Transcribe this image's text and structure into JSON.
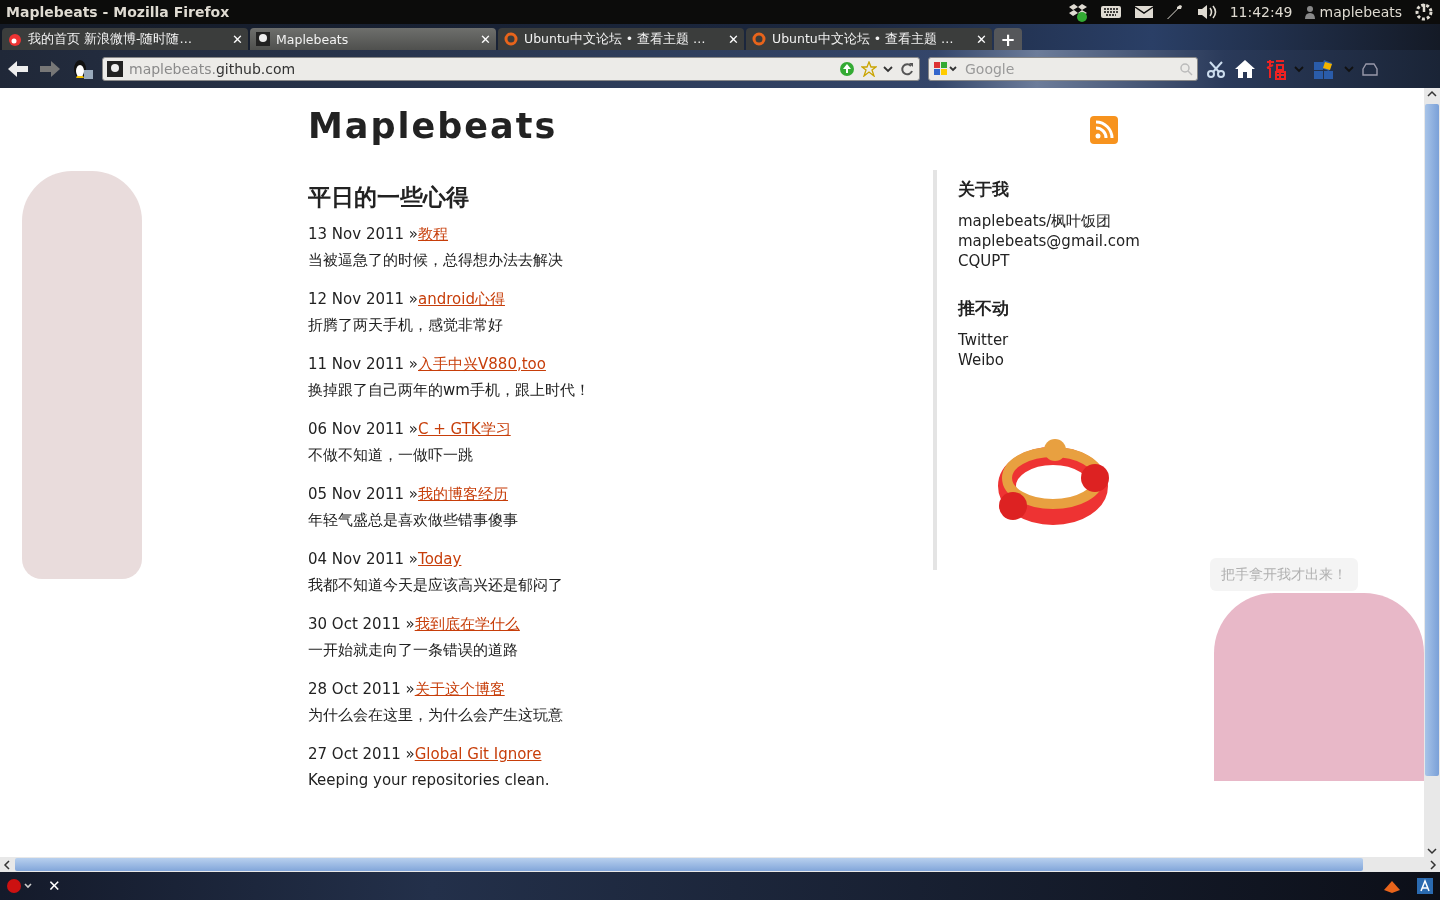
{
  "os_panel": {
    "title": "Maplebeats - Mozilla Firefox",
    "clock": "11:42:49",
    "user": "maplebeats"
  },
  "tabs": [
    {
      "label": "我的首页 新浪微博-随时随…",
      "selected": false,
      "close": "✕"
    },
    {
      "label": "Maplebeats",
      "selected": true,
      "close": "✕"
    },
    {
      "label": "Ubuntu中文论坛 • 查看主题 …",
      "selected": false,
      "close": "✕"
    },
    {
      "label": "Ubuntu中文论坛 • 查看主题 …",
      "selected": false,
      "close": "✕"
    }
  ],
  "new_tab": "+",
  "address_bar": {
    "url_subdomain": "maplebeats.",
    "url_domain": "github.com"
  },
  "search": {
    "placeholder": "Google"
  },
  "blog": {
    "title": "Maplebeats",
    "heading": "平日的一些心得",
    "posts": [
      {
        "date": "13 Nov 2011 »",
        "title": "教程",
        "summary": "当被逼急了的时候，总得想办法去解决"
      },
      {
        "date": "12 Nov 2011 »",
        "title": "android心得",
        "summary": "折腾了两天手机，感觉非常好"
      },
      {
        "date": "11 Nov 2011 »",
        "title": "入手中兴V880,too",
        "summary": "换掉跟了自己两年的wm手机，跟上时代！"
      },
      {
        "date": "06 Nov 2011 »",
        "title": "C + GTK学习",
        "summary": "不做不知道，一做吓一跳"
      },
      {
        "date": "05 Nov 2011 »",
        "title": "我的博客经历",
        "summary": "年轻气盛总是喜欢做些错事傻事"
      },
      {
        "date": "04 Nov 2011 »",
        "title": "Today",
        "summary": "我都不知道今天是应该高兴还是郁闷了"
      },
      {
        "date": "30 Oct 2011 »",
        "title": "我到底在学什么",
        "summary": "一开始就走向了一条错误的道路"
      },
      {
        "date": "28 Oct 2011 »",
        "title": "关于这个博客",
        "summary": "为什么会在这里，为什么会产生这玩意"
      },
      {
        "date": "27 Oct 2011 »",
        "title": "Global Git Ignore",
        "summary": "Keeping your repositories clean."
      }
    ],
    "sidebar": [
      {
        "heading": "关于我",
        "lines": [
          "maplebeats/枫叶饭团",
          "maplebeats@gmail.com",
          "CQUPT"
        ]
      },
      {
        "heading": "推不动",
        "lines": [
          "Twitter",
          "Weibo"
        ]
      }
    ],
    "tip": "把手拿开我才出来！"
  },
  "status_bar": {
    "close": "✕"
  }
}
